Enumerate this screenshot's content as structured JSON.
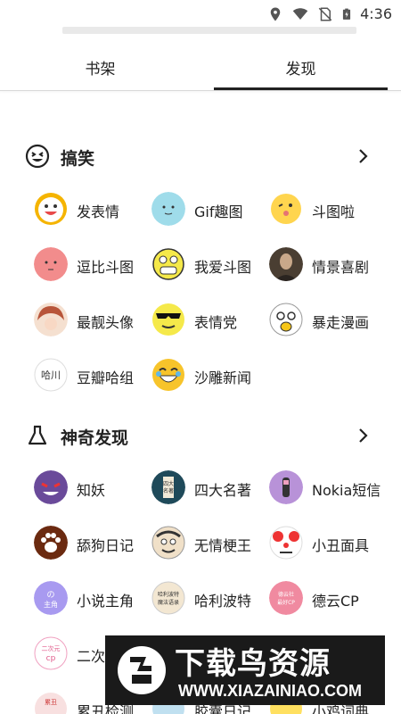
{
  "status_bar": {
    "time": "4:36",
    "icons": [
      "location-icon",
      "wifi-icon",
      "no-sim-icon",
      "battery-charging-icon"
    ]
  },
  "tabs": [
    {
      "label": "书架",
      "active": false
    },
    {
      "label": "发现",
      "active": true
    }
  ],
  "sections": [
    {
      "title": "搞笑",
      "icon": "smiley-icon",
      "items": [
        {
          "label": "发表情",
          "icon": "smile-face-avatar",
          "color": "#f5c518"
        },
        {
          "label": "Gif趣图",
          "icon": "light-blue-face-avatar",
          "color": "#9fdcea"
        },
        {
          "label": "斗图啦",
          "icon": "wink-face-avatar",
          "color": "#ffd54f"
        },
        {
          "label": "逗比斗图",
          "icon": "pink-face-avatar",
          "color": "#f28c8c"
        },
        {
          "label": "我爱斗图",
          "icon": "grin-face-avatar",
          "color": "#f5e94a"
        },
        {
          "label": "情景喜剧",
          "icon": "portrait-avatar",
          "color": "#6b5a48"
        },
        {
          "label": "最靓头像",
          "icon": "anime-girl-avatar",
          "color": "#c96a52"
        },
        {
          "label": "表情党",
          "icon": "sunglasses-face-avatar",
          "color": "#f5e94a"
        },
        {
          "label": "暴走漫画",
          "icon": "rage-face-avatar",
          "color": "#f0f0f0"
        },
        {
          "label": "豆瓣哈组",
          "icon": "douban-avatar",
          "color": "#ffffff"
        },
        {
          "label": "沙雕新闻",
          "icon": "laughing-face-avatar",
          "color": "#f7c42b"
        }
      ]
    },
    {
      "title": "神奇发现",
      "icon": "flask-icon",
      "items": [
        {
          "label": "知妖",
          "icon": "gengar-avatar",
          "color": "#6a4a9a"
        },
        {
          "label": "四大名著",
          "icon": "book-avatar",
          "color": "#1f4a5a"
        },
        {
          "label": "Nokia短信",
          "icon": "nokia-phone-avatar",
          "color": "#b892d8"
        },
        {
          "label": "舔狗日记",
          "icon": "paw-avatar",
          "color": "#6b2a10"
        },
        {
          "label": "无情梗王",
          "icon": "cartoon-man-avatar",
          "color": "#e8e8e8"
        },
        {
          "label": "小丑面具",
          "icon": "clown-avatar",
          "color": "#ffffff"
        },
        {
          "label": "小说主角",
          "icon": "novel-hero-avatar",
          "color": "#a89af0"
        },
        {
          "label": "哈利波特",
          "icon": "harry-potter-avatar",
          "color": "#f3e7d2"
        },
        {
          "label": "德云CP",
          "icon": "deyun-cp-avatar",
          "color": "#f08aa0"
        },
        {
          "label": "二次",
          "icon": "anime-cp-avatar",
          "color": "#ffd0e0"
        },
        {
          "label": "",
          "icon": "blank-avatar",
          "color": "#ffffff"
        },
        {
          "label": "",
          "icon": "blank-avatar",
          "color": "#ffffff"
        },
        {
          "label": "累丑检测",
          "icon": "ugly-test-avatar",
          "color": "#f8e0e0"
        },
        {
          "label": "胶囊日记",
          "icon": "capsule-avatar",
          "color": "#c0e0f0"
        },
        {
          "label": "小鸡词典",
          "icon": "chick-avatar",
          "color": "#ffe060"
        }
      ]
    }
  ],
  "watermark": {
    "title": "下载鸟资源",
    "url": "WWW.XIAZAINIAO.COM"
  }
}
